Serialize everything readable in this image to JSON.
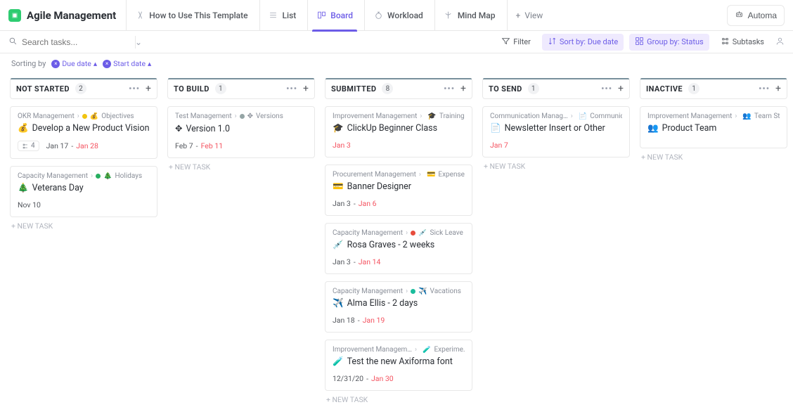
{
  "app": {
    "title": "Agile Management"
  },
  "tabs": [
    {
      "label": "How to Use This Template",
      "icon": "template-icon"
    },
    {
      "label": "List",
      "icon": "list-icon"
    },
    {
      "label": "Board",
      "icon": "board-icon",
      "active": true
    },
    {
      "label": "Workload",
      "icon": "workload-icon"
    },
    {
      "label": "Mind Map",
      "icon": "mindmap-icon"
    }
  ],
  "add_view_label": "View",
  "automations_label": "Automa",
  "search": {
    "placeholder": "Search tasks..."
  },
  "toolbar": {
    "filter": "Filter",
    "sort": "Sort by: Due date",
    "group": "Group by: Status",
    "subtasks": "Subtasks"
  },
  "sort_row": {
    "prefix": "Sorting by",
    "chips": [
      "Due date",
      "Start date"
    ]
  },
  "columns": [
    {
      "title": "NOT STARTED",
      "count": "2",
      "accent": "#78909c",
      "cards": [
        {
          "crumb_a": "OKR Management",
          "crumb_b": "Objectives",
          "crumb_emoji": "💰",
          "dot": "yellow",
          "title_emoji": "💰",
          "title": "Develop a New Product Vision",
          "subtasks": "4",
          "start": "Jan 17",
          "sep": " - ",
          "due": "Jan 28"
        },
        {
          "crumb_a": "Capacity Management",
          "crumb_b": "Holidays",
          "crumb_emoji": "🎄",
          "dot": "green",
          "title_emoji": "🎄",
          "title": "Veterans Day",
          "start": "Nov 10",
          "sep": "",
          "due": ""
        }
      ]
    },
    {
      "title": "TO BUILD",
      "count": "1",
      "accent": "#78909c",
      "cards": [
        {
          "crumb_a": "Test Management",
          "crumb_b": "Versions",
          "crumb_emoji": "✥",
          "dot": "grey",
          "title_emoji": "✥",
          "title": "Version 1.0",
          "start": "Feb 7",
          "sep": " - ",
          "due": "Feb 11"
        }
      ]
    },
    {
      "title": "SUBMITTED",
      "count": "8",
      "accent": "#78909c",
      "cards": [
        {
          "crumb_a": "Improvement Management",
          "crumb_b": "Trainings",
          "crumb_emoji": "🎓",
          "dot": "grey",
          "title_emoji": "🎓",
          "title": "ClickUp Beginner Class",
          "start": "",
          "sep": "",
          "due": "Jan 3"
        },
        {
          "crumb_a": "Procurement Management",
          "crumb_b": "Expenses",
          "crumb_emoji": "💳",
          "dot": "orange",
          "title_emoji": "💳",
          "title": "Banner Designer",
          "start": "Jan 3",
          "sep": " - ",
          "due": "Jan 6"
        },
        {
          "crumb_a": "Capacity Management",
          "crumb_b": "Sick Leave",
          "crumb_emoji": "💉",
          "dot": "red",
          "title_emoji": "💉",
          "title": "Rosa Graves - 2 weeks",
          "start": "Jan 3",
          "sep": " - ",
          "due": "Jan 14"
        },
        {
          "crumb_a": "Capacity Management",
          "crumb_b": "Vacations",
          "crumb_emoji": "✈️",
          "dot": "teal",
          "title_emoji": "✈️",
          "title": "Alma Ellis - 2 days",
          "start": "Jan 18",
          "sep": " - ",
          "due": "Jan 19"
        },
        {
          "crumb_a": "Improvement Managem…",
          "crumb_b": "Experime…",
          "crumb_emoji": "🧪",
          "dot": "teal",
          "title_emoji": "🧪",
          "title": "Test the new Axiforma font",
          "start": "12/31/20",
          "sep": " - ",
          "due": "Jan 30"
        }
      ]
    },
    {
      "title": "TO SEND",
      "count": "1",
      "accent": "#78909c",
      "cards": [
        {
          "crumb_a": "Communication Manag…",
          "crumb_b": "Communica…",
          "crumb_emoji": "📄",
          "dot": "grey",
          "title_emoji": "📄",
          "title": "Newsletter Insert or Other",
          "start": "",
          "sep": "",
          "due": "Jan 7"
        }
      ]
    },
    {
      "title": "INACTIVE",
      "count": "1",
      "accent": "#78909c",
      "cards": [
        {
          "crumb_a": "Improvement Management",
          "crumb_b": "Team Status",
          "crumb_emoji": "👥",
          "dot": "teal",
          "title_emoji": "👥",
          "title": "Product Team",
          "start": "",
          "sep": "",
          "due": ""
        }
      ]
    }
  ],
  "new_task_label": "+ NEW TASK"
}
